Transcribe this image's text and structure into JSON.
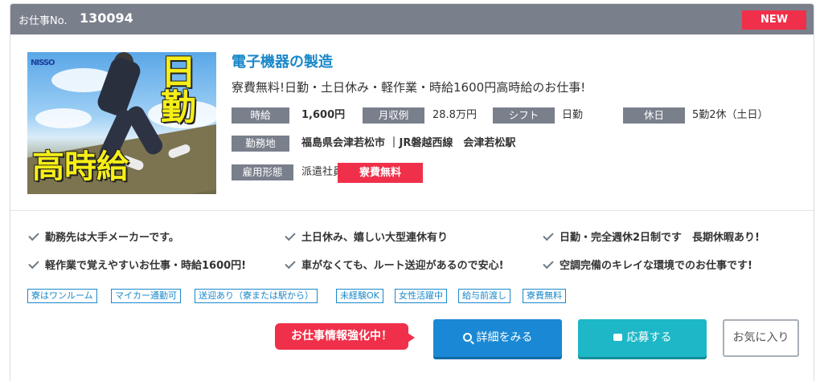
{
  "header": {
    "job_no_label": "お仕事No.",
    "job_no": "130094",
    "new_badge": "NEW"
  },
  "thumbnail": {
    "logo_text": "NISSO",
    "text_nikkin": "日勤",
    "text_koujikyu": "高時給"
  },
  "job": {
    "title": "電子機器の製造",
    "catch": "寮費無料!日勤・土日休み・軽作業・時給1600円高時給のお仕事!"
  },
  "conditions": {
    "hourly_label": "時給",
    "hourly_value": "1,600円",
    "monthly_label": "月収例",
    "monthly_value": "28.8万円",
    "shift_label": "シフト",
    "shift_value": "日勤",
    "holiday_label": "休日",
    "holiday_value": "5勤2休（土日）",
    "location_label": "勤務地",
    "location_value": "福島県会津若松市 ｜JR磐越西線　会津若松駅",
    "employment_label": "雇用形態",
    "employment_value": "派遣社員",
    "dorm_badge": "寮費無料"
  },
  "features": [
    "勤務先は大手メーカーです。",
    "土日休み、嬉しい大型連休有り",
    "日勤・完全週休2日制です　長期休暇あり!",
    "軽作業で覚えやすいお仕事・時給1600円!",
    "車がなくても、ルート送迎があるので安心!",
    "空調完備のキレイな環境でのお仕事です!"
  ],
  "keywords": [
    "寮はワンルーム",
    "マイカー通勤可",
    "送迎あり（寮または駅から）",
    "未経験OK",
    "女性活躍中",
    "給与前渡し",
    "寮費無料"
  ],
  "actions": {
    "promo_label": "お仕事情報強化中！",
    "detail_label": "詳細をみる",
    "apply_label": "応募する",
    "favorite_label": "お気に入り"
  },
  "colors": {
    "header_bg": "#7a7f8c",
    "accent_red": "#f0304a",
    "title_blue": "#1a88c9",
    "detail_btn": "#1a88d4",
    "apply_btn": "#1db7c7"
  },
  "icons": {
    "feature_check": "check-icon",
    "detail": "search-icon",
    "apply": "apply-icon"
  }
}
